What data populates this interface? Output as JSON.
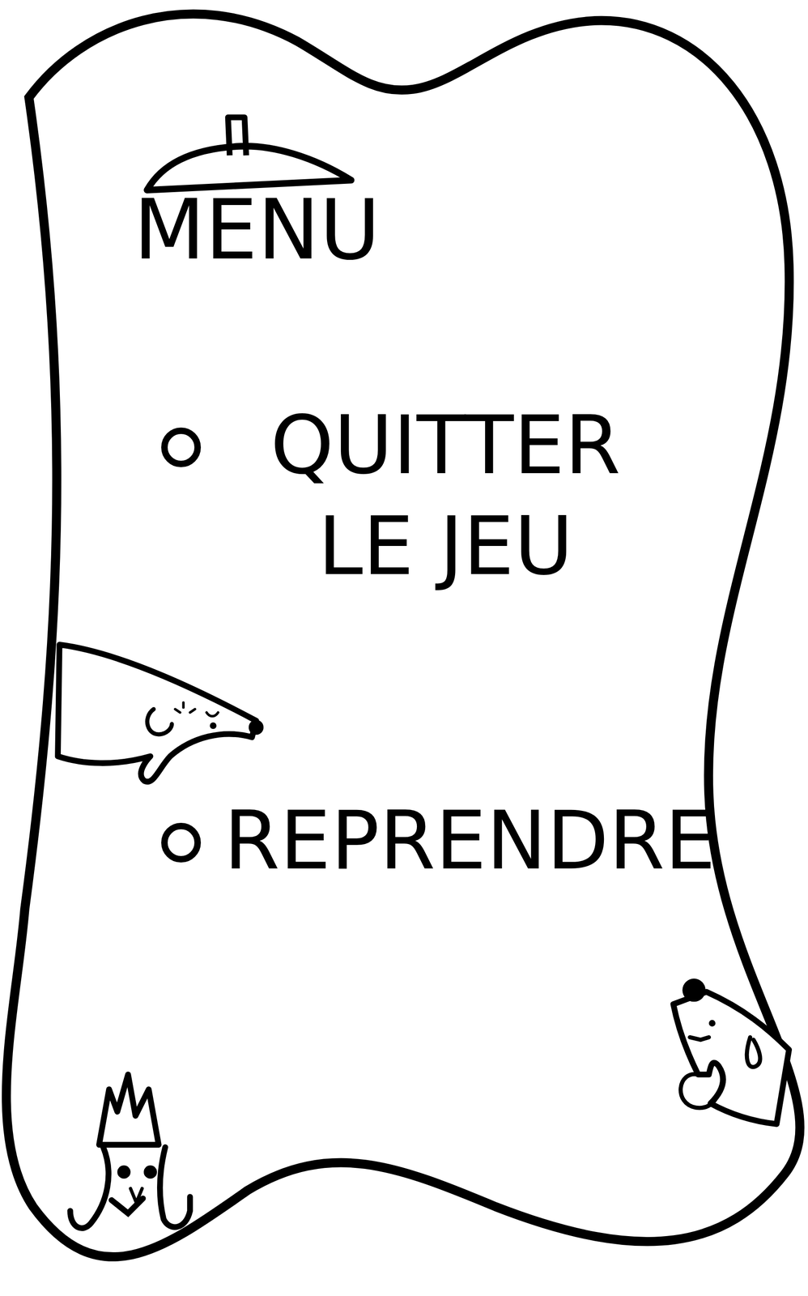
{
  "title": "MENU",
  "items": [
    {
      "label": "QUITTER LE JEU"
    },
    {
      "label": "REPRENDRE"
    }
  ]
}
